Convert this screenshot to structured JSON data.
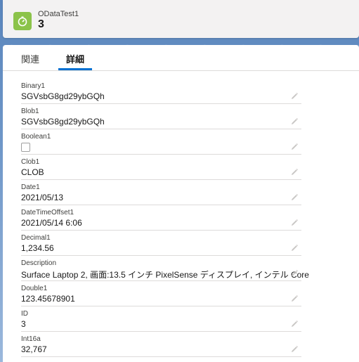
{
  "header": {
    "object_type": "ODataTest1",
    "record_title": "3",
    "icon": "stopwatch-icon",
    "icon_color": "#8bc34a"
  },
  "tabs": [
    {
      "label": "関連",
      "active": false
    },
    {
      "label": "詳細",
      "active": true
    }
  ],
  "fields": [
    {
      "label": "Binary1",
      "value": "SGVsbG8gd29ybGQh"
    },
    {
      "label": "Blob1",
      "value": "SGVsbG8gd29ybGQh"
    },
    {
      "label": "Boolean1",
      "value": "",
      "type": "checkbox",
      "checked": false
    },
    {
      "label": "Clob1",
      "value": "CLOB"
    },
    {
      "label": "Date1",
      "value": "2021/05/13"
    },
    {
      "label": "DateTimeOffset1",
      "value": "2021/05/14 6:06"
    },
    {
      "label": "Decimal1",
      "value": "1,234.56"
    },
    {
      "label": "Description",
      "value": "Surface Laptop 2, 画面:13.5 インチ PixelSense ディスプレイ, インテル Core"
    },
    {
      "label": "Double1",
      "value": "123.45678901"
    },
    {
      "label": "ID",
      "value": "3"
    },
    {
      "label": "Int16a",
      "value": "32,767"
    }
  ],
  "colors": {
    "active_tab_underline": "#0070d2",
    "divider": "#dddbda"
  }
}
